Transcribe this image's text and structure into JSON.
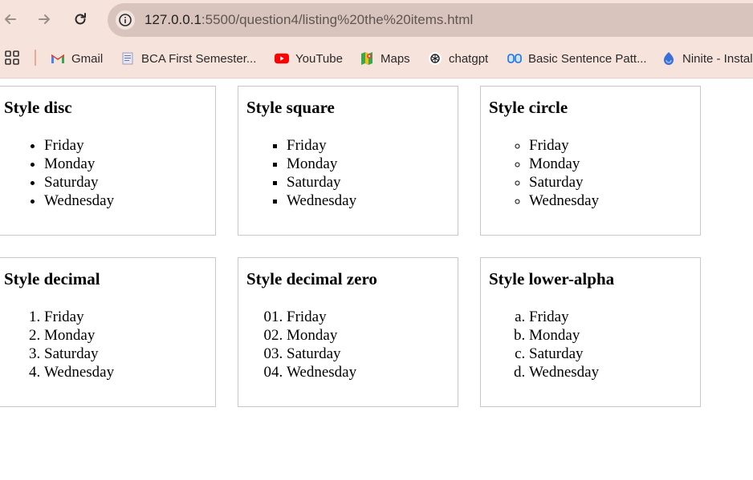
{
  "browser": {
    "url_host": "127.0.0.1",
    "url_path": ":5500/question4/listing%20the%20items.html"
  },
  "bookmarks": [
    {
      "label": "Gmail",
      "icon": "gmail-icon"
    },
    {
      "label": "BCA First Semester...",
      "icon": "document-icon"
    },
    {
      "label": "YouTube",
      "icon": "youtube-icon"
    },
    {
      "label": "Maps",
      "icon": "maps-icon"
    },
    {
      "label": "chatgpt",
      "icon": "chatgpt-icon"
    },
    {
      "label": "Basic Sentence Patt...",
      "icon": "glasses-icon"
    },
    {
      "label": "Ninite - Instal",
      "icon": "ninite-icon"
    }
  ],
  "cards": [
    {
      "title": "Style disc",
      "list_style": "disc",
      "items": [
        "Friday",
        "Monday",
        "Saturday",
        "Wednesday"
      ]
    },
    {
      "title": "Style square",
      "list_style": "square",
      "items": [
        "Friday",
        "Monday",
        "Saturday",
        "Wednesday"
      ]
    },
    {
      "title": "Style circle",
      "list_style": "circle",
      "items": [
        "Friday",
        "Monday",
        "Saturday",
        "Wednesday"
      ]
    },
    {
      "title": "Style decimal",
      "list_style": "decimal",
      "items": [
        "Friday",
        "Monday",
        "Saturday",
        "Wednesday"
      ]
    },
    {
      "title": "Style decimal zero",
      "list_style": "decimal-leading-zero",
      "items": [
        "Friday",
        "Monday",
        "Saturday",
        "Wednesday"
      ]
    },
    {
      "title": "Style lower-alpha",
      "list_style": "lower-alpha",
      "items": [
        "Friday",
        "Monday",
        "Saturday",
        "Wednesday"
      ]
    }
  ]
}
